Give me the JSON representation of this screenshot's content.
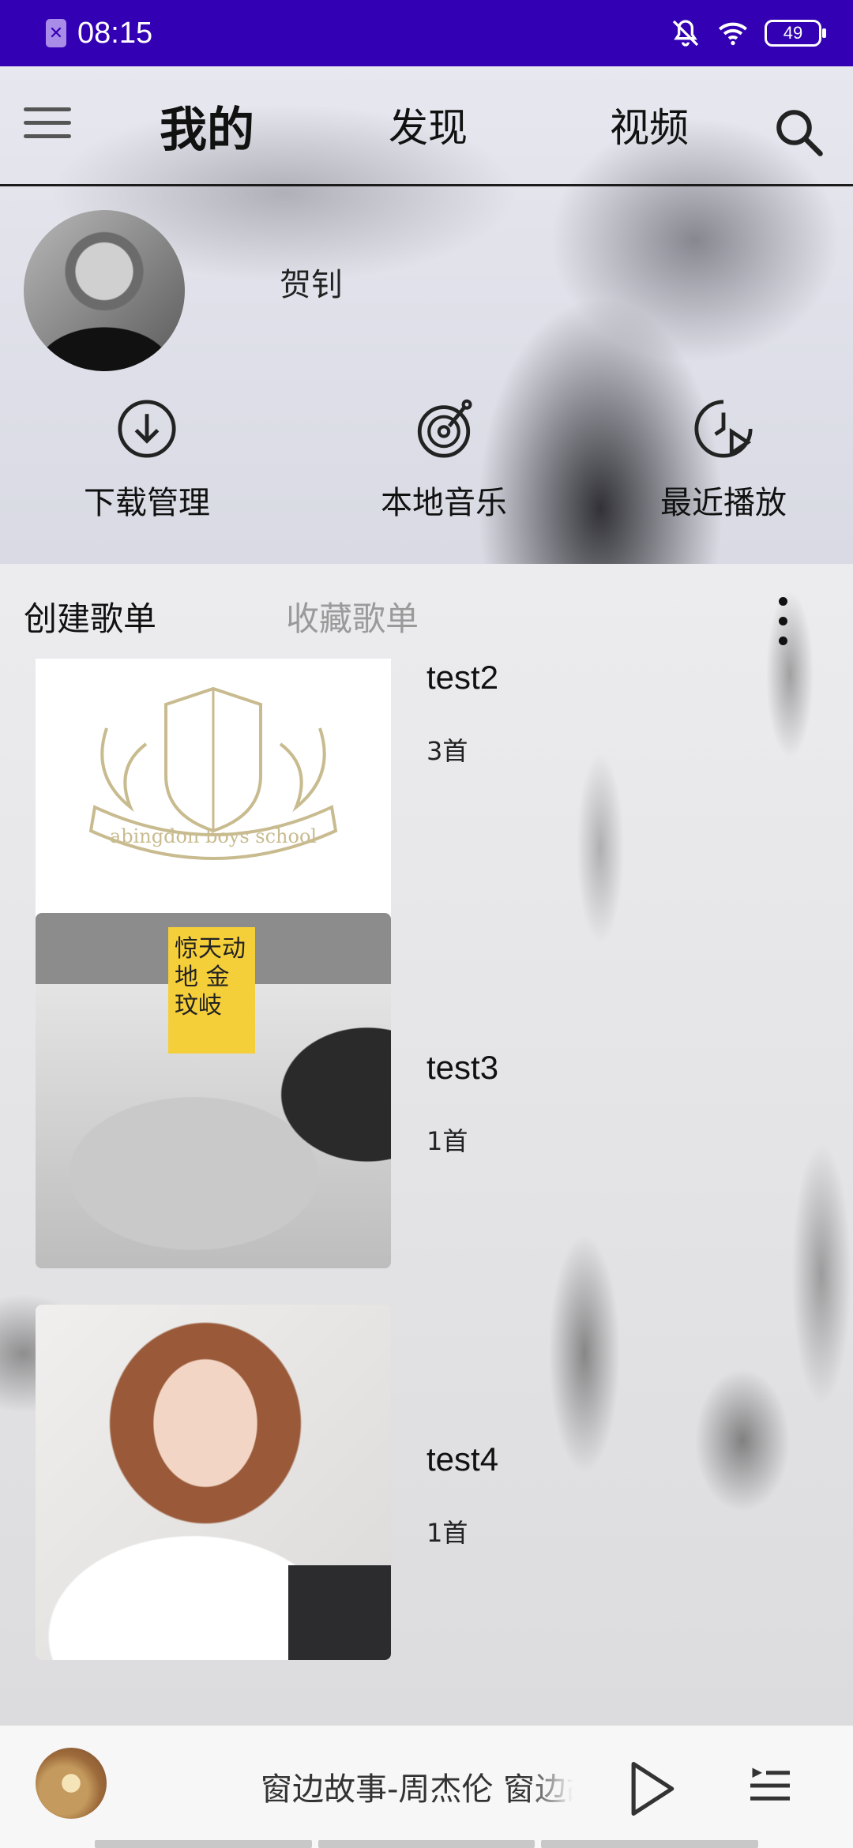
{
  "status_bar": {
    "time": "08:15",
    "battery": "49",
    "icons": [
      "app-badge-icon",
      "mute-bell-icon",
      "wifi-icon",
      "battery-icon"
    ]
  },
  "nav": {
    "tabs": [
      {
        "label": "我的",
        "active": true
      },
      {
        "label": "发现",
        "active": false
      },
      {
        "label": "视频",
        "active": false
      }
    ]
  },
  "profile": {
    "name": "贺钊"
  },
  "quick_actions": [
    {
      "label": "下载管理",
      "icon": "download-icon"
    },
    {
      "label": "本地音乐",
      "icon": "local-music-icon"
    },
    {
      "label": "最近播放",
      "icon": "recent-play-icon"
    }
  ],
  "playlist_tabs": {
    "created": "创建歌单",
    "favorites": "收藏歌单"
  },
  "playlists": [
    {
      "name": "test2",
      "count": "3首",
      "cover_text": "abingdon boys school"
    },
    {
      "name": "test3",
      "count": "1首",
      "cover_text": "惊天动地 金玟岐"
    },
    {
      "name": "test4",
      "count": "1首",
      "cover_text": ""
    }
  ],
  "player": {
    "now_playing": "窗边故事-周杰伦 窗边故事"
  },
  "colors": {
    "status_bar": "#3300b3",
    "accent_yellow": "#f5cf3a"
  }
}
